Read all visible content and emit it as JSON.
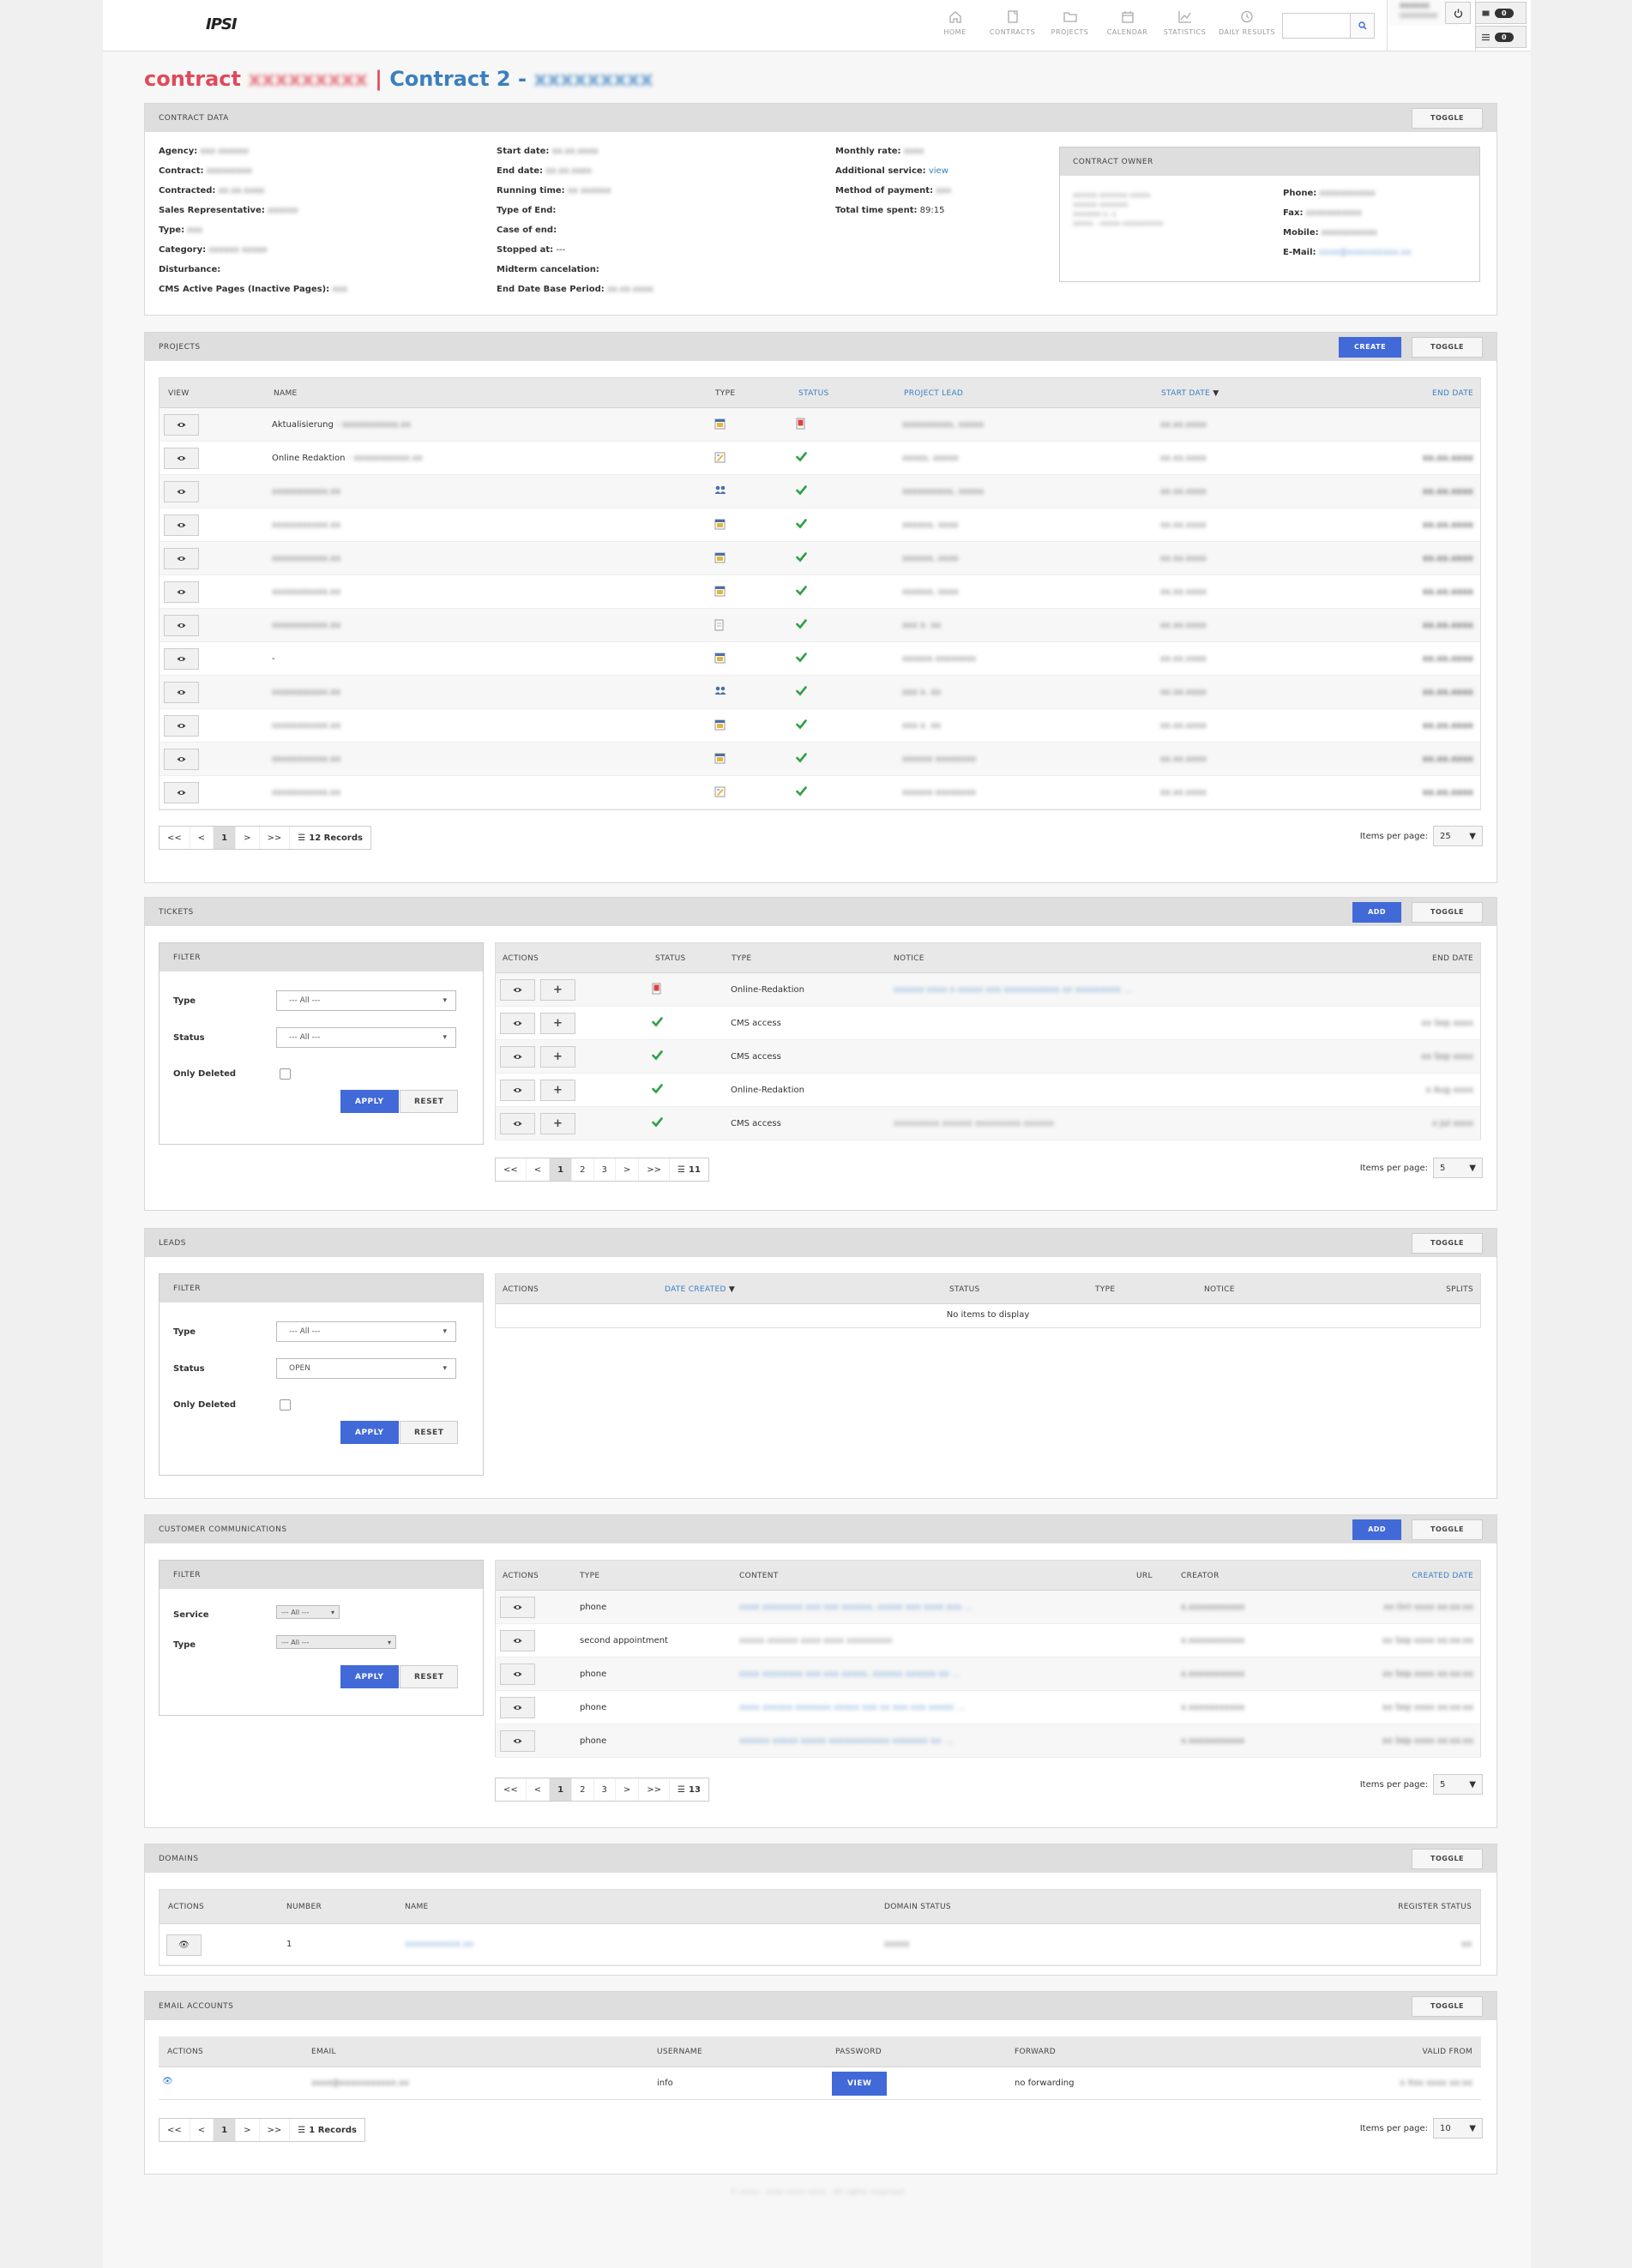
{
  "app": {
    "logo": "IPSI"
  },
  "nav": [
    {
      "label": "HOME",
      "icon": "home-icon"
    },
    {
      "label": "CONTRACTS",
      "icon": "contract-icon"
    },
    {
      "label": "PROJECTS",
      "icon": "folder-icon"
    },
    {
      "label": "CALENDAR",
      "icon": "calendar-icon"
    },
    {
      "label": "STATISTICS",
      "icon": "chart-icon"
    },
    {
      "label": "DAILY RESULTS",
      "icon": "clock-icon"
    }
  ],
  "header": {
    "user": "xxxxxx",
    "badge1": "0",
    "badge2": "0"
  },
  "title": {
    "prefix": "contract",
    "contract_no": "xxxxxxxxx",
    "separator": "|",
    "name": "Contract 2",
    "dash": "-",
    "domain": "xxxxxxxxx"
  },
  "contract_data": {
    "title": "CONTRACT DATA",
    "toggle": "TOGGLE",
    "col1": [
      {
        "label": "Agency:",
        "value": "xxx xxxxxx"
      },
      {
        "label": "Contract:",
        "value": "xxxxxxxxx"
      },
      {
        "label": "Contracted:",
        "value": "xx.xx.xxxx"
      },
      {
        "label": "Sales Representative:",
        "value": "xxxxxx"
      },
      {
        "label": "Type:",
        "value": "xxx"
      },
      {
        "label": "Category:",
        "value": "xxxxxx xxxxx"
      },
      {
        "label": "Disturbance:",
        "value": ""
      },
      {
        "label": "CMS Active Pages (Inactive Pages):",
        "value": "xxx"
      }
    ],
    "col2": [
      {
        "label": "Start date:",
        "value": "xx.xx.xxxx"
      },
      {
        "label": "End date:",
        "value": "xx.xx.xxxx"
      },
      {
        "label": "Running time:",
        "value": "xx xxxxxx"
      },
      {
        "label": "Type of End:",
        "value": ""
      },
      {
        "label": "Case of end:",
        "value": ""
      },
      {
        "label": "Stopped at:",
        "value": "---"
      },
      {
        "label": "Midterm cancelation:",
        "value": ""
      },
      {
        "label": "End Date Base Period:",
        "value": "xx.xx.xxxx"
      }
    ],
    "col3": [
      {
        "label": "Monthly rate:",
        "value": "xxxx"
      },
      {
        "label": "Additional service:",
        "value": "view"
      },
      {
        "label": "Method of payment:",
        "value": "xxx"
      },
      {
        "label": "Total time spent:",
        "value": "89:15"
      }
    ]
  },
  "owner": {
    "title": "CONTRACT OWNER",
    "address": [
      "xxxxxx xxxxxxx xxxxx",
      "xxxxxx xxxxxxx",
      "xxxxxxx x. x",
      "xxxxx - xxxxx xxxxxxxxxx"
    ],
    "fields": [
      {
        "label": "Phone:",
        "value": "xxxxxxxxxxx"
      },
      {
        "label": "Fax:",
        "value": "xxxxxxxxxxx"
      },
      {
        "label": "Mobile:",
        "value": "xxxxxxxxxxx"
      },
      {
        "label": "E-Mail:",
        "value": "xxxx@xxxxxxxxxx.xx"
      }
    ]
  },
  "projects": {
    "title": "PROJECTS",
    "create": "CREATE",
    "toggle": "TOGGLE",
    "columns": [
      "VIEW",
      "NAME",
      "TYPE",
      "STATUS",
      "PROJECT LEAD",
      "START DATE",
      "END DATE"
    ],
    "rows": [
      {
        "name": "Aktualisierung",
        "name_extra": "- xxxxxxxxxxx.xx",
        "type_icon": "calendar-doc-icon",
        "status": "pending",
        "lead": "xxxxxxxxxx, xxxxx",
        "start": "xx.xx.xxxx",
        "end": ""
      },
      {
        "name": "Online Redaktion",
        "name_extra": "- xxxxxxxxxxx.xx",
        "type_icon": "edit-doc-icon",
        "status": "done",
        "lead": "xxxxx, xxxxx",
        "start": "xx.xx.xxxx",
        "end": "xx.xx.xxxx"
      },
      {
        "name": "",
        "name_extra": "xxxxxxxxxxx.xx",
        "type_icon": "users-icon",
        "status": "done",
        "lead": "xxxxxxxxxx, xxxxx",
        "start": "xx.xx.xxxx",
        "end": "xx.xx.xxxx"
      },
      {
        "name": "",
        "name_extra": "xxxxxxxxxxx.xx",
        "type_icon": "calendar-doc-icon",
        "status": "done",
        "lead": "xxxxxx, xxxx",
        "start": "xx.xx.xxxx",
        "end": "xx.xx.xxxx"
      },
      {
        "name": "",
        "name_extra": "xxxxxxxxxxx.xx",
        "type_icon": "calendar-doc-icon",
        "status": "done",
        "lead": "xxxxxx, xxxx",
        "start": "xx.xx.xxxx",
        "end": "xx.xx.xxxx"
      },
      {
        "name": "",
        "name_extra": "xxxxxxxxxxx.xx",
        "type_icon": "calendar-doc-icon",
        "status": "done",
        "lead": "xxxxxx, xxxx",
        "start": "xx.xx.xxxx",
        "end": "xx.xx.xxxx"
      },
      {
        "name": "",
        "name_extra": "xxxxxxxxxxx.xx",
        "type_icon": "file-icon",
        "status": "done",
        "lead": "xxx x. xx",
        "start": "xx.xx.xxxx",
        "end": "xx.xx.xxxx"
      },
      {
        "name": "-",
        "name_extra": "",
        "type_icon": "calendar-doc-icon",
        "status": "done",
        "lead": "xxxxxx xxxxxxxx",
        "start": "xx.xx.xxxx",
        "end": "xx.xx.xxxx"
      },
      {
        "name": "",
        "name_extra": "xxxxxxxxxxx.xx",
        "type_icon": "users-icon",
        "status": "done",
        "lead": "xxx x. xx",
        "start": "xx.xx.xxxx",
        "end": "xx.xx.xxxx"
      },
      {
        "name": "",
        "name_extra": "xxxxxxxxxxx.xx",
        "type_icon": "calendar-doc-icon",
        "status": "done",
        "lead": "xxx x. xx",
        "start": "xx.xx.xxxx",
        "end": "xx.xx.xxxx"
      },
      {
        "name": "",
        "name_extra": "xxxxxxxxxxx.xx",
        "type_icon": "calendar-doc-icon",
        "status": "done",
        "lead": "xxxxxx xxxxxxxx",
        "start": "xx.xx.xxxx",
        "end": "xx.xx.xxxx"
      },
      {
        "name": "",
        "name_extra": "xxxxxxxxxxx.xx",
        "type_icon": "edit-doc-icon",
        "status": "done",
        "lead": "xxxxxx xxxxxxxx",
        "start": "xx.xx.xxxx",
        "end": "xx.xx.xxxx"
      }
    ],
    "pager": {
      "first": "<<",
      "prev": "<",
      "page": "1",
      "next": ">",
      "last": ">>",
      "records": "12 Records"
    },
    "ipp_label": "Items per page:",
    "ipp_value": "25"
  },
  "tickets": {
    "title": "TICKETS",
    "add": "ADD",
    "toggle": "TOGGLE",
    "filter": {
      "title": "FILTER",
      "type_label": "Type",
      "type_value": "--- All ---",
      "status_label": "Status",
      "status_value": "--- All ---",
      "deleted_label": "Only Deleted",
      "apply": "APPLY",
      "reset": "RESET"
    },
    "columns": [
      "ACTIONS",
      "STATUS",
      "TYPE",
      "NOTICE",
      "END DATE"
    ],
    "rows": [
      {
        "status": "pending",
        "type": "Online-Redaktion",
        "notice": "xxxxxx xxxx x xxxxx xxx xxxxxxxxxxx xx xxxxxxxxx ...",
        "end": ""
      },
      {
        "status": "done",
        "type": "CMS access",
        "notice": "",
        "end": "xx Sep xxxx"
      },
      {
        "status": "done",
        "type": "CMS access",
        "notice": "",
        "end": "xx Sep xxxx"
      },
      {
        "status": "done",
        "type": "Online-Redaktion",
        "notice": "",
        "end": "x Aug xxxx"
      },
      {
        "status": "done",
        "type": "CMS access",
        "notice": "xxxxxxxxx xxxxxx xxxxxxxxx xxxxxx",
        "end": "x Jul xxxx"
      }
    ],
    "pager": {
      "first": "<<",
      "prev": "<",
      "pages": [
        "1",
        "2",
        "3"
      ],
      "next": ">",
      "last": ">>",
      "records": "11"
    },
    "ipp_label": "Items per page:",
    "ipp_value": "5"
  },
  "leads": {
    "title": "LEADS",
    "toggle": "TOGGLE",
    "filter": {
      "title": "FILTER",
      "type_label": "Type",
      "type_value": "--- All ---",
      "status_label": "Status",
      "status_value": "OPEN",
      "deleted_label": "Only Deleted",
      "apply": "APPLY",
      "reset": "RESET"
    },
    "columns": [
      "ACTIONS",
      "DATE CREATED",
      "STATUS",
      "TYPE",
      "NOTICE",
      "SPLITS"
    ],
    "empty": "No items to display"
  },
  "comms": {
    "title": "CUSTOMER COMMUNICATIONS",
    "add": "ADD",
    "toggle": "TOGGLE",
    "filter": {
      "title": "FILTER",
      "service_label": "Service",
      "service_value": "--- All ---",
      "type_label": "Type",
      "type_value": "--- All ---",
      "apply": "APPLY",
      "reset": "RESET"
    },
    "columns": [
      "ACTIONS",
      "TYPE",
      "CONTENT",
      "URL",
      "CREATOR",
      "CREATED DATE"
    ],
    "rows": [
      {
        "type": "phone",
        "content": "xxxx xxxxxxxx xxx xxx xxxxxx, xxxxx xxx xxxx xxx ...",
        "creator": "x.xxxxxxxxxxx",
        "date": "xx Oct xxxx xx:xx:xx"
      },
      {
        "type": "second appointment",
        "content": "xxxxx xxxxxx xxxx xxxx xxxxxxxxx",
        "creator": "x.xxxxxxxxxxx",
        "date": "xx Sep xxxx xx:xx:xx"
      },
      {
        "type": "phone",
        "content": "xxxx xxxxxxxx xxx xxx xxxxx, xxxxxx xxxxxx xx ...",
        "creator": "x.xxxxxxxxxxx",
        "date": "xx Sep xxxx xx:xx:xx"
      },
      {
        "type": "phone",
        "content": "xxxx xxxxxx xxxxxxx xxxxx xxx xx xxx xxx xxxxx ...",
        "creator": "x.xxxxxxxxxxx",
        "date": "xx Sep xxxx xx:xx:xx"
      },
      {
        "type": "phone",
        "content": "xxxxxx xxxxx xxxxx xxxxxxxxxxxx xxxxxxx xx. ...",
        "creator": "x.xxxxxxxxxxx",
        "date": "xx Sep xxxx xx:xx:xx"
      }
    ],
    "pager": {
      "first": "<<",
      "prev": "<",
      "pages": [
        "1",
        "2",
        "3"
      ],
      "next": ">",
      "last": ">>",
      "records": "13"
    },
    "ipp_label": "Items per page:",
    "ipp_value": "5"
  },
  "domains": {
    "title": "DOMAINS",
    "toggle": "TOGGLE",
    "columns": [
      "ACTIONS",
      "NUMBER",
      "NAME",
      "DOMAIN STATUS",
      "REGISTER STATUS"
    ],
    "rows": [
      {
        "number": "1",
        "name": "xxxxxxxxxxx.xx",
        "status": "xxxxx",
        "register": "xx"
      }
    ]
  },
  "emails": {
    "title": "EMAIL ACCOUNTS",
    "toggle": "TOGGLE",
    "columns": [
      "ACTIONS",
      "EMAIL",
      "USERNAME",
      "PASSWORD",
      "FORWARD",
      "VALID FROM"
    ],
    "rows": [
      {
        "email": "xxxx@xxxxxxxxxxx.xx",
        "username": "info",
        "password": "VIEW",
        "forward": "no forwarding",
        "valid": "x Xxx xxxx xx:xx"
      }
    ],
    "pager": {
      "first": "<<",
      "prev": "<",
      "page": "1",
      "next": ">",
      "last": ">>",
      "records": "1 Records"
    },
    "ipp_label": "Items per page:",
    "ipp_value": "10"
  },
  "footer": "© xxxx - xxxx xxxx xxxx - All rights reserved",
  "colors": {
    "accent": "#4169d8",
    "title_red": "#e04a5a",
    "title_blue": "#3a7fc0",
    "check": "#2ea043",
    "link": "#3a7fc0"
  }
}
